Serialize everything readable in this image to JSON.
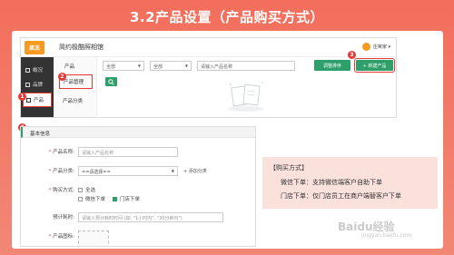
{
  "slide": {
    "title": "3.2产品设置（产品购买方式）"
  },
  "app": {
    "logo_text": "果冻",
    "name": "简约极酷照相馆",
    "user": "庄荣家 ▾",
    "sidebar": [
      {
        "label": "概况",
        "icon": "chart-icon"
      },
      {
        "label": "品牌",
        "icon": "shop-icon"
      },
      {
        "label": "产品",
        "icon": "box-icon"
      }
    ],
    "subnav": {
      "heading": "产品",
      "items": [
        "产品管理",
        "产品分类"
      ]
    },
    "toolbar": {
      "filter1": "全部",
      "filter2": "全部",
      "search_placeholder": "请输入产品名称",
      "sort_btn": "调整排序",
      "new_btn": "+ 新建产品",
      "search_icon": "search-icon"
    }
  },
  "badges": [
    "1",
    "2",
    "3",
    "4"
  ],
  "form": {
    "heading": "基本信息",
    "name_label": "产品名称:",
    "name_placeholder": "请输入产品名称",
    "category_label": "产品分类:",
    "category_value": "==请选择==",
    "add_category": "+ 添加分类",
    "method_label": "购买方式:",
    "method_all": "全选",
    "method_wechat": "微信下单",
    "method_store": "门店下单",
    "time_label": "预计耗时:",
    "time_placeholder": "请输入预计耗时时间   (如: \"1小时内\", \"30分钟内\")",
    "image_label": "产品图标:"
  },
  "info": {
    "title": "【购买方式】",
    "line1": "微信下单：支持微信端客户自助下单",
    "line2": "门店下单：仅门店员工在商户端替客户下单"
  },
  "watermark": {
    "main": "Baidu经验",
    "sub": "jingyan.baidu.com"
  }
}
